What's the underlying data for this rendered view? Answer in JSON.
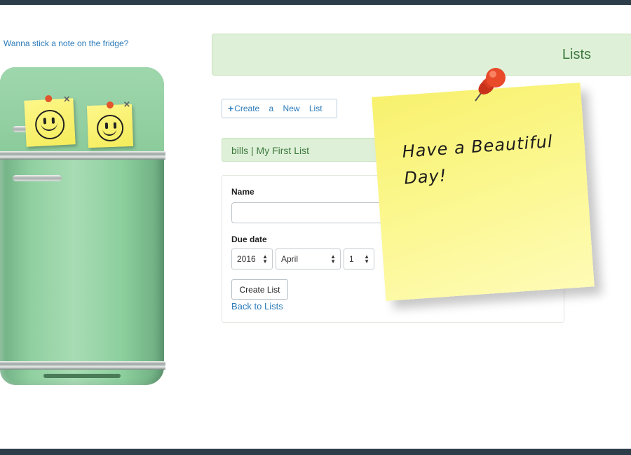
{
  "header": {
    "fridge_link": "Wanna stick a note on the fridge?"
  },
  "lists_panel": {
    "title": "Lists"
  },
  "toolbar": {
    "create_new_list_label": "Create a New List"
  },
  "list": {
    "label": "bills | My First List"
  },
  "form": {
    "name_label": "Name",
    "name_value": "",
    "due_date_label": "Due date",
    "year_value": "2016",
    "month_value": "April",
    "day_value": "1",
    "submit_label": "Create List",
    "back_link": "Back to Lists"
  },
  "sticky_note": {
    "text": "Have a Beautiful Day!"
  },
  "icons": {
    "plus": "plus-icon",
    "pushpin": "pushpin-icon",
    "smiley": "smiley-icon",
    "close": "close-icon",
    "select_arrows": "updown-arrow-icon"
  },
  "colors": {
    "accent_green_bg": "#dff0d8",
    "accent_green_text": "#3c7a3d",
    "link_blue": "#2a7ab8",
    "note_yellow": "#f8f16e",
    "bar_dark": "#2d3e4a"
  }
}
